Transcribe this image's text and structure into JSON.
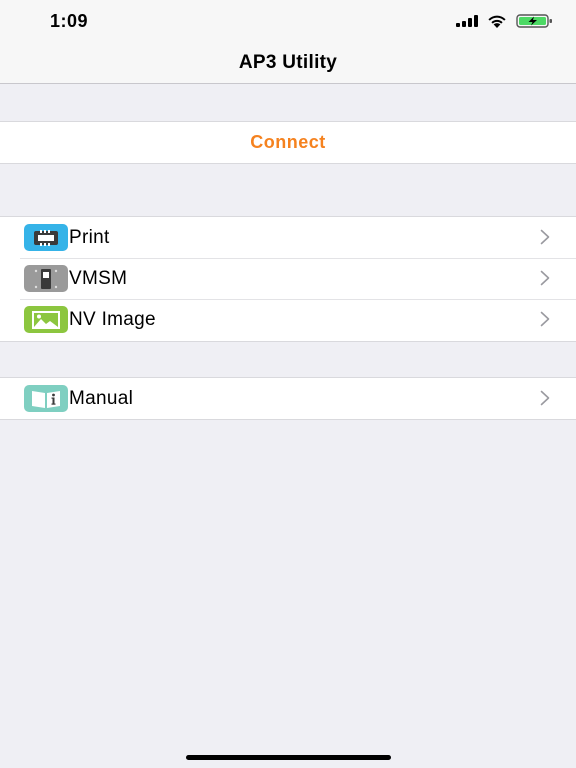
{
  "status_bar": {
    "time": "1:09",
    "icons": [
      "signal-icon",
      "wifi-icon",
      "battery-charging-icon"
    ]
  },
  "nav": {
    "title": "AP3 Utility"
  },
  "connect": {
    "label": "Connect",
    "color": "#f5821f"
  },
  "menu": {
    "items": [
      {
        "label": "Print",
        "icon": "printer-icon",
        "icon_color": "#35b3e8"
      },
      {
        "label": "VMSM",
        "icon": "switch-icon",
        "icon_color": "#9a9a9a"
      },
      {
        "label": "NV Image",
        "icon": "image-icon",
        "icon_color": "#8cc63f"
      }
    ]
  },
  "manual": {
    "label": "Manual",
    "icon": "book-info-icon",
    "icon_color": "#7fcfc1"
  }
}
